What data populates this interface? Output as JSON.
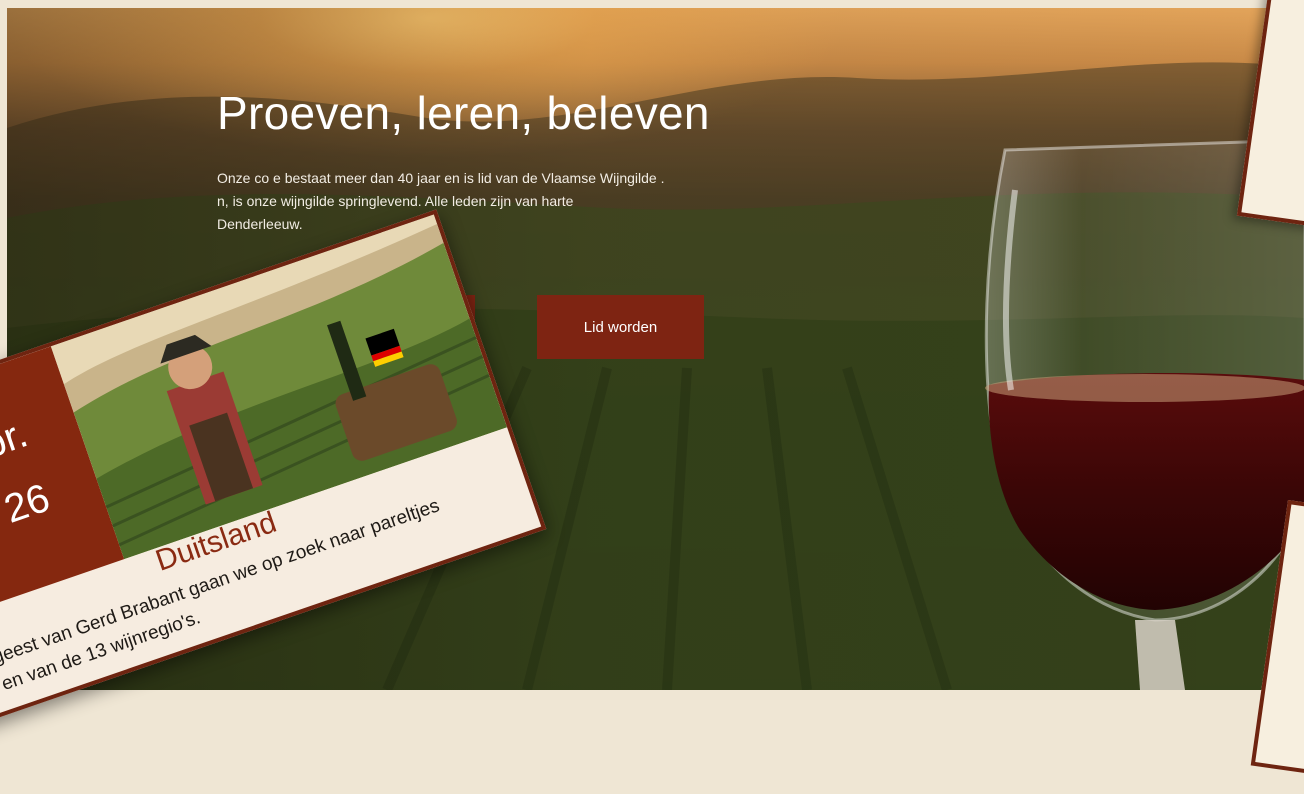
{
  "hero": {
    "title": "Proeven, leren, beleven",
    "intro_lines": [
      "Onze co                              e bestaat meer dan 40 jaar en is lid van de Vlaamse Wijngilde .",
      "                                            n, is onze wijngilde springlevend. Alle leden zijn van harte",
      "                                            Denderleeuw."
    ],
    "button_partial_label": "",
    "button_join_label": "Lid worden"
  },
  "flyer": {
    "date_month": "pr.",
    "date_year": "26",
    "heading": "Duitsland",
    "text_line1": "geest van Gerd Brabant gaan we op zoek naar pareltjes",
    "text_line2": "en van de 13 wijnregio's."
  },
  "colors": {
    "accent": "#7e2412",
    "flyer_border": "#6e2410",
    "flyer_bg": "#f6ece0"
  }
}
